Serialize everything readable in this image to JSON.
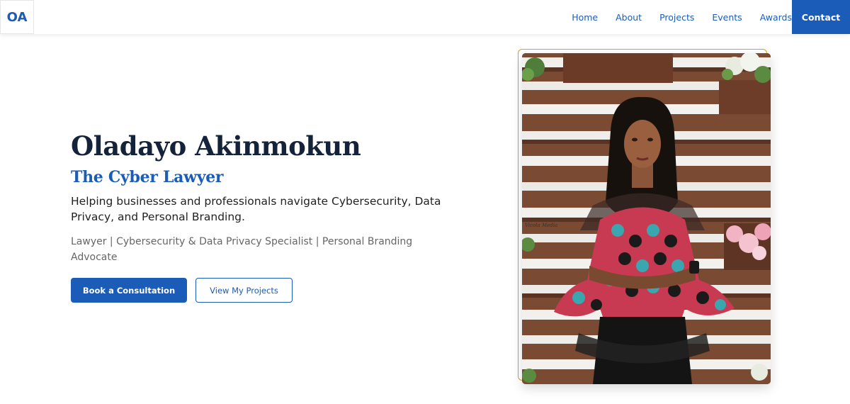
{
  "nav": {
    "logo": "OA",
    "links": [
      "Home",
      "About",
      "Projects",
      "Events",
      "Awards"
    ],
    "cta": "Contact"
  },
  "hero": {
    "name": "Oladayo Akinmokun",
    "tagline": "The Cyber Lawyer",
    "description": "Helping businesses and professionals navigate Cybersecurity, Data Privacy, and Personal Branding.",
    "roles": "Lawyer | Cybersecurity & Data Privacy Specialist | Personal Branding Advocate",
    "primary_button": "Book a Consultation",
    "secondary_button": "View My Projects"
  },
  "photo": {
    "watermark": "Vicola Media",
    "frame_color": "#d4a520"
  },
  "colors": {
    "brand": "#1a5cb8",
    "heading": "#14223a"
  }
}
